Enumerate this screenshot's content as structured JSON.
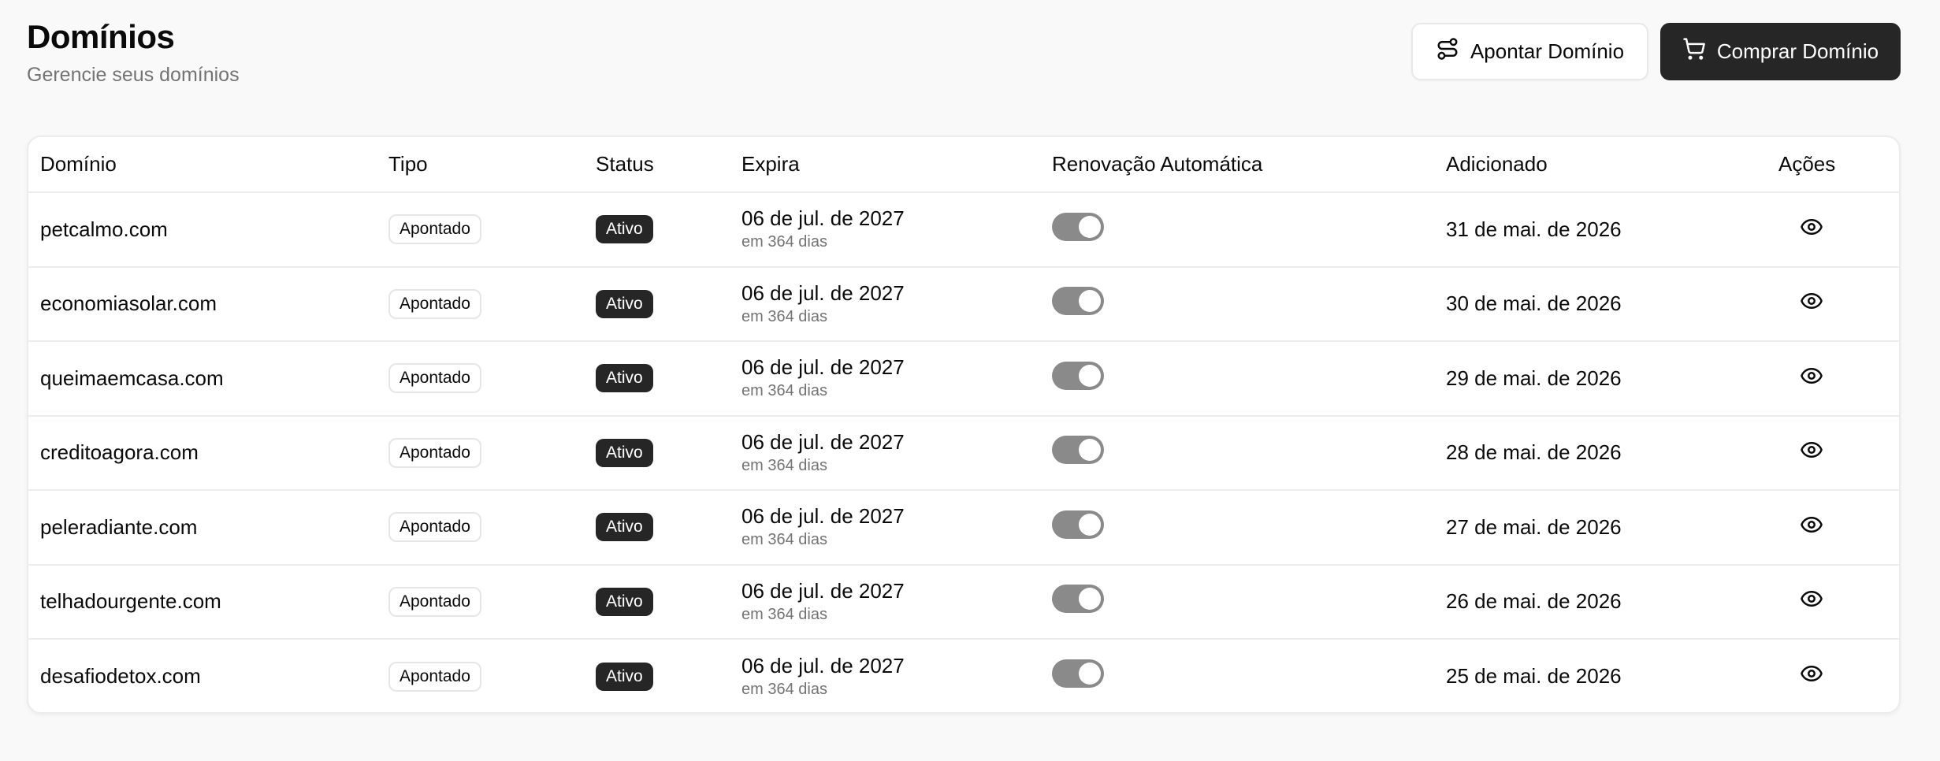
{
  "header": {
    "title": "Domínios",
    "subtitle": "Gerencie seus domínios",
    "point_button": "Apontar Domínio",
    "buy_button": "Comprar Domínio"
  },
  "table": {
    "columns": [
      "Domínio",
      "Tipo",
      "Status",
      "Expira",
      "Renovação Automática",
      "Adicionado",
      "Ações"
    ],
    "rows": [
      {
        "domain": "petcalmo.com",
        "type": "Apontado",
        "status": "Ativo",
        "expires": "06 de jul. de 2027",
        "expires_rel": "em 364 dias",
        "auto_renew": true,
        "added": "31 de mai. de 2026"
      },
      {
        "domain": "economiasolar.com",
        "type": "Apontado",
        "status": "Ativo",
        "expires": "06 de jul. de 2027",
        "expires_rel": "em 364 dias",
        "auto_renew": true,
        "added": "30 de mai. de 2026"
      },
      {
        "domain": "queimaemcasa.com",
        "type": "Apontado",
        "status": "Ativo",
        "expires": "06 de jul. de 2027",
        "expires_rel": "em 364 dias",
        "auto_renew": true,
        "added": "29 de mai. de 2026"
      },
      {
        "domain": "creditoagora.com",
        "type": "Apontado",
        "status": "Ativo",
        "expires": "06 de jul. de 2027",
        "expires_rel": "em 364 dias",
        "auto_renew": true,
        "added": "28 de mai. de 2026"
      },
      {
        "domain": "peleradiante.com",
        "type": "Apontado",
        "status": "Ativo",
        "expires": "06 de jul. de 2027",
        "expires_rel": "em 364 dias",
        "auto_renew": true,
        "added": "27 de mai. de 2026"
      },
      {
        "domain": "telhadourgente.com",
        "type": "Apontado",
        "status": "Ativo",
        "expires": "06 de jul. de 2027",
        "expires_rel": "em 364 dias",
        "auto_renew": true,
        "added": "26 de mai. de 2026"
      },
      {
        "domain": "desafiodetox.com",
        "type": "Apontado",
        "status": "Ativo",
        "expires": "06 de jul. de 2027",
        "expires_rel": "em 364 dias",
        "auto_renew": true,
        "added": "25 de mai. de 2026"
      }
    ]
  },
  "icons": {
    "point_button": "route-icon",
    "buy_button": "shopping-cart-icon",
    "row_action": "eye-icon"
  },
  "colors": {
    "primary": "#262626",
    "toggle_on": "#8a8a8a",
    "muted_text": "#737373",
    "background": "#f9f9f9"
  }
}
